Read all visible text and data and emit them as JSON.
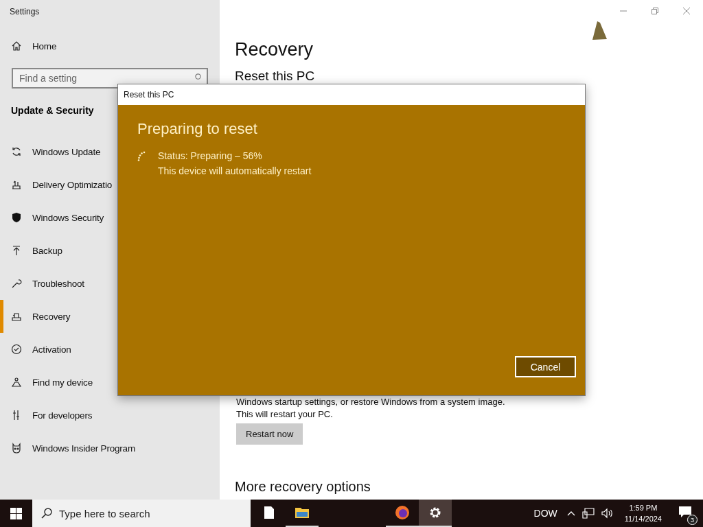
{
  "window": {
    "title": "Settings"
  },
  "sidebar": {
    "home": "Home",
    "search": {
      "placeholder": "Find a setting"
    },
    "section": "Update & Security",
    "items": [
      {
        "label": "Windows Update",
        "selected": false
      },
      {
        "label": "Delivery Optimizatio",
        "selected": false
      },
      {
        "label": "Windows Security",
        "selected": false
      },
      {
        "label": "Backup",
        "selected": false
      },
      {
        "label": "Troubleshoot",
        "selected": false
      },
      {
        "label": "Recovery",
        "selected": true
      },
      {
        "label": "Activation",
        "selected": false
      },
      {
        "label": "Find my device",
        "selected": false
      },
      {
        "label": "For developers",
        "selected": false
      },
      {
        "label": "Windows Insider Program",
        "selected": false
      }
    ]
  },
  "main": {
    "title": "Recovery",
    "section": "Reset this PC",
    "description_lines": [
      "Windows startup settings, or restore Windows from a system image.",
      "This will restart your PC."
    ],
    "restart_button": "Restart now",
    "more_heading": "More recovery options"
  },
  "dialog": {
    "title": "Reset this PC",
    "heading": "Preparing to reset",
    "status": "Status: Preparing – 56%",
    "note": "This device will automatically restart",
    "cancel_button": "Cancel"
  },
  "taskbar": {
    "search": {
      "placeholder": "Type here to search"
    },
    "apps": [
      {
        "running": false,
        "selected": false
      },
      {
        "running": true,
        "selected": false
      },
      {
        "running": true,
        "selected": false
      },
      {
        "running": true,
        "selected": true
      }
    ],
    "tray_label": "DOW",
    "time": "1:59 PM",
    "date": "11/14/2024",
    "notification_count": "3"
  }
}
